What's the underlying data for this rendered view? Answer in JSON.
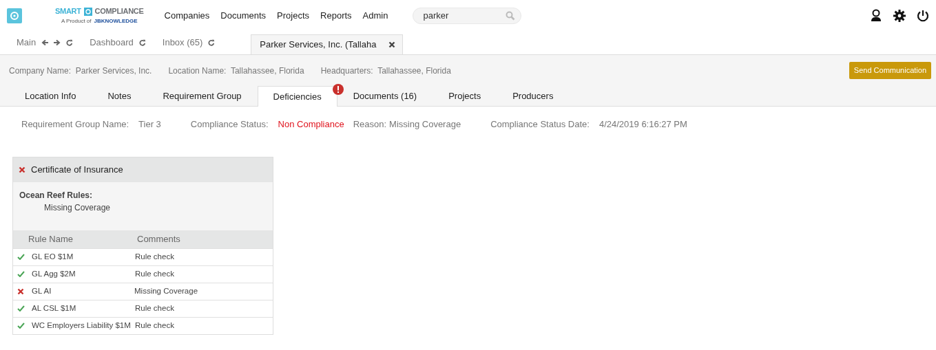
{
  "logo": {
    "word_1": "SMART",
    "word_2": "COMPLIANCE",
    "tagline": "A Product of",
    "brand": "JBKNOWLEDGE"
  },
  "nav": [
    "Companies",
    "Documents",
    "Projects",
    "Reports",
    "Admin"
  ],
  "search": {
    "value": "parker"
  },
  "workspace_tabs": [
    {
      "label": "Main",
      "navigable": true,
      "refreshable": true,
      "selected": false,
      "closable": false
    },
    {
      "label": "Dashboard",
      "navigable": false,
      "refreshable": true,
      "selected": false,
      "closable": false
    },
    {
      "label": "Inbox (65)",
      "navigable": false,
      "refreshable": true,
      "selected": false,
      "closable": false
    },
    {
      "label": "Parker Services, Inc. (Tallaha",
      "navigable": false,
      "refreshable": false,
      "selected": true,
      "closable": true
    }
  ],
  "company_info": [
    {
      "label": "Company Name:",
      "value": "Parker Services, Inc."
    },
    {
      "label": "Location Name:",
      "value": "Tallahassee, Florida"
    },
    {
      "label": "Headquarters:",
      "value": "Tallahassee, Florida"
    }
  ],
  "send_button": "Send Communication",
  "detail_tabs": [
    {
      "label": "Location Info",
      "selected": false,
      "alert": false
    },
    {
      "label": "Notes",
      "selected": false,
      "alert": false
    },
    {
      "label": "Requirement Group",
      "selected": false,
      "alert": false
    },
    {
      "label": "Deficiencies",
      "selected": true,
      "alert": true
    },
    {
      "label": "Documents (16)",
      "selected": false,
      "alert": false
    },
    {
      "label": "Projects",
      "selected": false,
      "alert": false
    },
    {
      "label": "Producers",
      "selected": false,
      "alert": false
    }
  ],
  "status": [
    {
      "label": "Requirement Group Name:",
      "value": "Tier 3",
      "alert": false
    },
    {
      "label": "Compliance Status:",
      "value": "Non Compliance",
      "alert": true
    },
    {
      "label": "Reason:",
      "value": "Missing Coverage",
      "alert": false
    },
    {
      "label": "Compliance Status Date:",
      "value": "4/24/2019 6:16:27 PM",
      "alert": false
    }
  ],
  "certificate": {
    "title": "Certificate of Insurance",
    "passed": false,
    "rules_heading": "Ocean Reef Rules:",
    "rules_detail": "Missing Coverage",
    "columns": [
      "Rule Name",
      "Comments"
    ],
    "rows": [
      {
        "name": "GL EO $1M",
        "comment": "Rule check",
        "passed": true
      },
      {
        "name": "GL Agg $2M",
        "comment": "Rule check",
        "passed": true
      },
      {
        "name": "GL AI",
        "comment": "Missing Coverage",
        "passed": false
      },
      {
        "name": "AL CSL $1M",
        "comment": "Rule check",
        "passed": true
      },
      {
        "name": "WC Employers Liability $1M",
        "comment": "Rule check",
        "passed": true
      }
    ]
  }
}
